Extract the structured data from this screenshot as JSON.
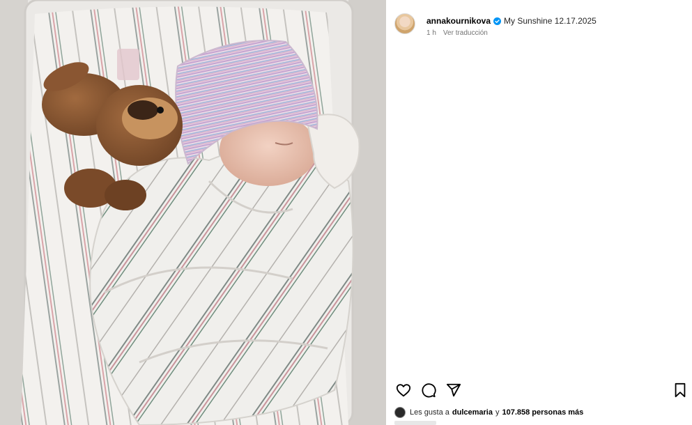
{
  "post": {
    "username": "annakournikova",
    "caption": "My Sunshine 12.17.2025",
    "time_ago": "1 h",
    "translate_label": "Ver traducción",
    "likes": {
      "prefix": "Les gusta a",
      "user": "dulcemaria",
      "joiner": "y",
      "count_text": "107.858 personas más"
    }
  },
  "icons": {
    "verified": "verified-badge-icon",
    "like": "heart-icon",
    "comment": "comment-icon",
    "share": "share-icon",
    "save": "bookmark-icon"
  },
  "colors": {
    "verified_blue": "#0095f6",
    "text_secondary": "#737373"
  }
}
